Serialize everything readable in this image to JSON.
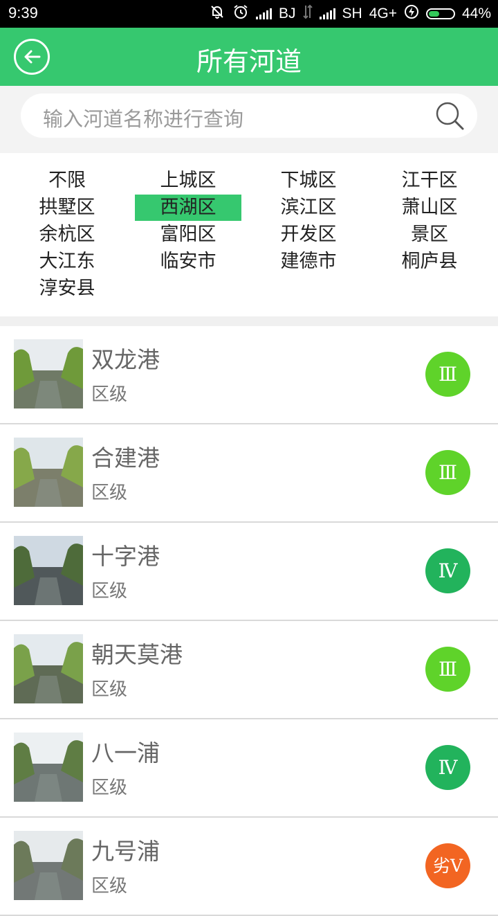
{
  "status_bar": {
    "time": "9:39",
    "carrier1": "BJ",
    "carrier2": "SH",
    "network": "4G+",
    "battery": "44%",
    "battery_level": 0.44,
    "icons": [
      "mute-icon",
      "alarm-icon",
      "signal-icon",
      "data-icon",
      "signal-icon",
      "charging-icon",
      "battery-icon"
    ]
  },
  "header": {
    "title": "所有河道",
    "back_icon": "back-arrow-icon",
    "color": "#36c86f"
  },
  "search": {
    "placeholder": "输入河道名称进行查询",
    "icon": "search-icon"
  },
  "districts": [
    {
      "label": "不限"
    },
    {
      "label": "上城区"
    },
    {
      "label": "下城区"
    },
    {
      "label": "江干区"
    },
    {
      "label": "拱墅区"
    },
    {
      "label": "西湖区",
      "selected": true
    },
    {
      "label": "滨江区"
    },
    {
      "label": "萧山区"
    },
    {
      "label": "余杭区"
    },
    {
      "label": "富阳区"
    },
    {
      "label": "开发区"
    },
    {
      "label": "景区"
    },
    {
      "label": "大江东"
    },
    {
      "label": "临安市"
    },
    {
      "label": "建德市"
    },
    {
      "label": "桐庐县"
    },
    {
      "label": "淳安县"
    }
  ],
  "rivers": [
    {
      "name": "双龙港",
      "level": "区级",
      "grade": "Ⅲ",
      "grade_color": "#5fd32a"
    },
    {
      "name": "合建港",
      "level": "区级",
      "grade": "Ⅲ",
      "grade_color": "#5fd32a"
    },
    {
      "name": "十字港",
      "level": "区级",
      "grade": "Ⅳ",
      "grade_color": "#22b35c"
    },
    {
      "name": "朝天莫港",
      "level": "区级",
      "grade": "Ⅲ",
      "grade_color": "#5fd32a"
    },
    {
      "name": "八一浦",
      "level": "区级",
      "grade": "Ⅳ",
      "grade_color": "#22b35c"
    },
    {
      "name": "九号浦",
      "level": "区级",
      "grade": "劣Ⅴ",
      "grade_color": "#f26522"
    }
  ]
}
